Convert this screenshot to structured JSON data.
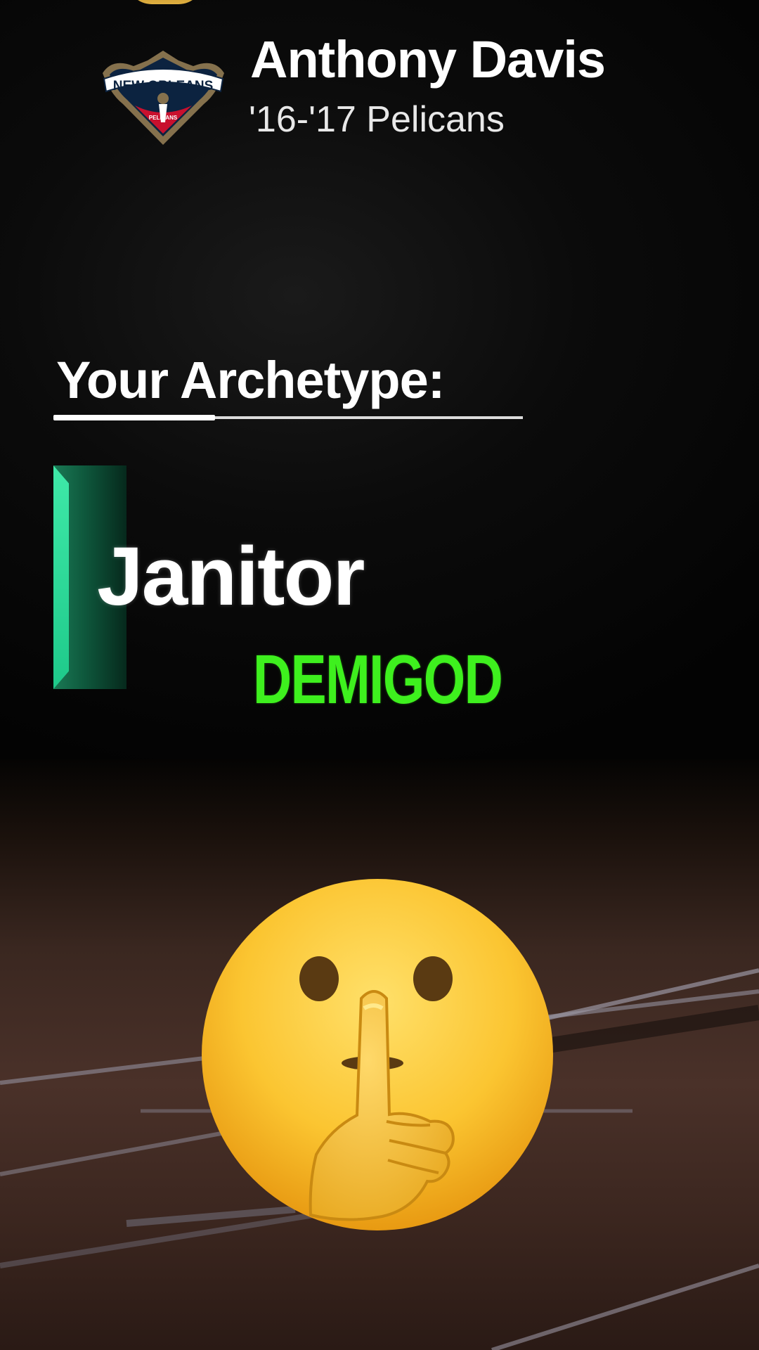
{
  "player": {
    "name": "Anthony Davis",
    "season": "'16-'17 Pelicans",
    "team_logo": {
      "icon": "new-orleans-pelicans-logo",
      "text": "NEW ORLEANS",
      "subtext": "PELICANS",
      "colors": {
        "navy": "#0c2340",
        "red": "#c8102e",
        "gold": "#85714d"
      }
    }
  },
  "archetype": {
    "heading": "Your Archetype:",
    "name": "Janitor",
    "accent_color": "#1ec98a"
  },
  "overlay": {
    "rating_text": "DEMIGOD",
    "rating_color": "#3ef01e",
    "emoji": "shushing-face-emoji"
  }
}
